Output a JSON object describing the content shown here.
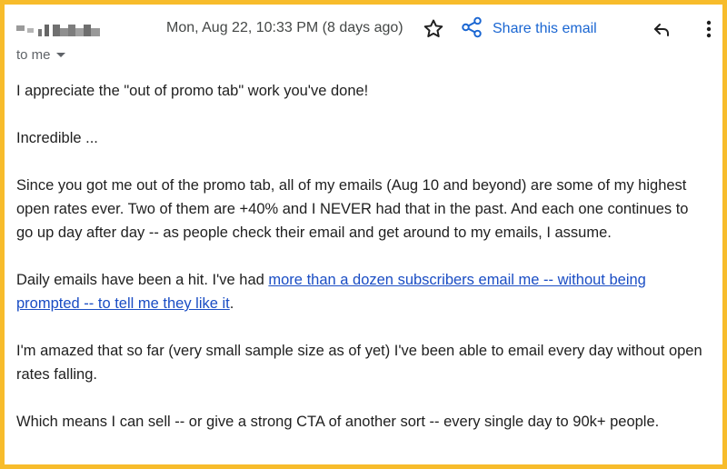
{
  "header": {
    "sender_name": "",
    "date": "Mon, Aug 22, 10:33 PM (8 days ago)",
    "share_label": "Share this email",
    "recipient": "to me"
  },
  "icons": {
    "star": "star-icon",
    "share": "share-icon",
    "reply": "reply-icon",
    "more": "more-vert-icon",
    "caret": "caret-down-icon"
  },
  "colors": {
    "frame_border": "#f7bc2b",
    "link": "#1a4dc4",
    "share_blue": "#1a66d2"
  },
  "message": {
    "p1": "I appreciate the \"out of promo tab\" work you've done!",
    "p2": "Incredible ...",
    "p3": "Since you got me out of the promo tab, all of my emails (Aug 10 and beyond) are some of my highest open rates ever. Two of them are +40% and I NEVER had that in the past. And each one continues to go up day after day -- as people check their email and get around to my emails, I assume.",
    "p4_before": "Daily emails have been a hit. I've had ",
    "p4_link": "more than a dozen subscribers email me -- without being prompted -- to tell me they like it",
    "p4_after": ".",
    "p5": "I'm amazed that so far (very small sample size as of yet) I've been able to email every day without open rates falling.",
    "p6": "Which means I can sell -- or give a strong CTA of another sort -- every single day to 90k+ people."
  }
}
